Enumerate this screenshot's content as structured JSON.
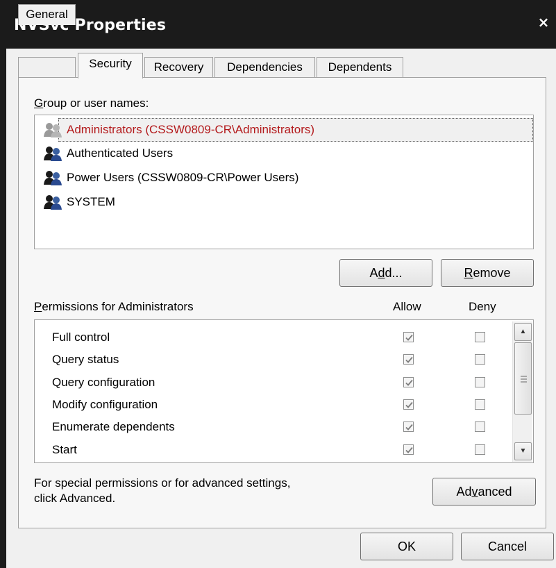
{
  "window": {
    "title": "NVSvc Properties",
    "close_glyph": "×"
  },
  "tabs": [
    {
      "label": "General",
      "active": false
    },
    {
      "label": "Security",
      "active": true
    },
    {
      "label": "Recovery",
      "active": false
    },
    {
      "label": "Dependencies",
      "active": false
    },
    {
      "label": "Dependents",
      "active": false
    }
  ],
  "groups": {
    "label_prefix": "G",
    "label_rest": "roup or user names:",
    "items": [
      {
        "name": "Administrators (CSSW0809-CR\\Administrators)",
        "selected": true,
        "icon": "user-group-icon"
      },
      {
        "name": "Authenticated Users",
        "selected": false,
        "icon": "user-group-icon"
      },
      {
        "name": "Power Users (CSSW0809-CR\\Power Users)",
        "selected": false,
        "icon": "user-group-icon"
      },
      {
        "name": "SYSTEM",
        "selected": false,
        "icon": "user-group-icon"
      }
    ]
  },
  "buttons": {
    "add_pre": "A",
    "add_u": "d",
    "add_post": "d...",
    "remove_u": "R",
    "remove_post": "emove",
    "advanced_pre": "Ad",
    "advanced_u": "v",
    "advanced_post": "anced",
    "ok": "OK",
    "cancel": "Cancel"
  },
  "permissions": {
    "label_u": "P",
    "label_rest": "ermissions for Administrators",
    "allow_header": "Allow",
    "deny_header": "Deny",
    "rows": [
      {
        "name": "Full control",
        "allow": true,
        "deny": false
      },
      {
        "name": "Query status",
        "allow": true,
        "deny": false
      },
      {
        "name": "Query configuration",
        "allow": true,
        "deny": false
      },
      {
        "name": "Modify configuration",
        "allow": true,
        "deny": false
      },
      {
        "name": "Enumerate dependents",
        "allow": true,
        "deny": false
      },
      {
        "name": "Start",
        "allow": true,
        "deny": false
      }
    ]
  },
  "advanced_note": {
    "line1": "For special permissions or for advanced settings,",
    "line2": "click Advanced."
  },
  "colors": {
    "titlebar": "#1b1b1b",
    "selected_text": "#b3191b",
    "dialog_bg": "#f0f0f0"
  }
}
